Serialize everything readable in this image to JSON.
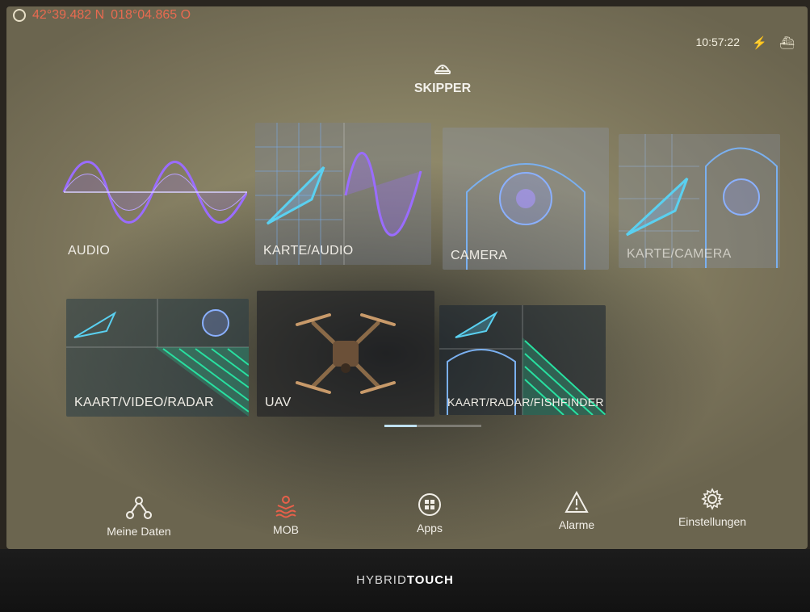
{
  "status_bar": {
    "latitude": "42°39.482 N",
    "longitude": "018°04.865 O",
    "time": "10:57:22"
  },
  "profile": {
    "icon": "skipper-cap-icon",
    "name": "SKIPPER"
  },
  "tiles": [
    {
      "id": "audio",
      "label": "AUDIO"
    },
    {
      "id": "karte-audio",
      "label": "KARTE/AUDIO"
    },
    {
      "id": "camera",
      "label": "CAMERA"
    },
    {
      "id": "karte-camera",
      "label": "KARTE/CAMERA"
    },
    {
      "id": "kaart-video-radar",
      "label": "KAART/VIDEO/RADAR"
    },
    {
      "id": "uav",
      "label": "UAV"
    },
    {
      "id": "kaart-radar-fishfinder",
      "label": "KAART/RADAR/FISHFINDER"
    }
  ],
  "page_indicator": {
    "current_page": 1,
    "total_pages": 3
  },
  "dock": [
    {
      "label": "Meine Daten",
      "icon": "waypoints-icon"
    },
    {
      "label": "MOB",
      "icon": "man-overboard-icon",
      "color": "#e8604a"
    },
    {
      "label": "Apps",
      "icon": "apps-grid-icon"
    },
    {
      "label": "Alarme",
      "icon": "warning-triangle-icon"
    },
    {
      "label": "Einstellungen",
      "icon": "gear-icon"
    }
  ],
  "device": {
    "brand_prefix": "HYBRID",
    "brand_suffix": "TOUCH"
  },
  "colors": {
    "accent_wave": "#9a6cff",
    "accent_radar": "#28e0a0",
    "accent_chart": "#5ad0f0",
    "mob": "#e8604a",
    "coordinates": "#e86a50"
  }
}
